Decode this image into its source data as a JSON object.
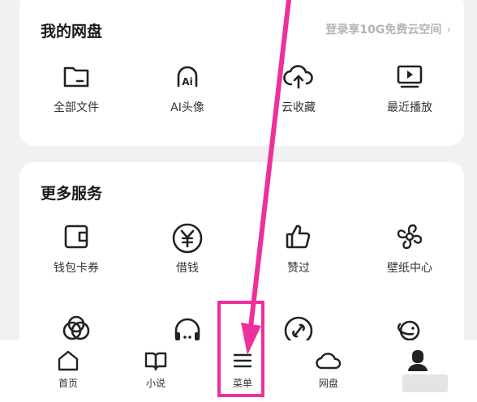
{
  "colors": {
    "background": "#f1f1f3",
    "card": "#ffffff",
    "icon": "#222222",
    "promo_text": "#b3b3b8",
    "annotation": "#ee2f9c"
  },
  "my_drive": {
    "title": "我的网盘",
    "promo_text": "登录享10G免费云空间",
    "promo_chevron": "›",
    "items": [
      {
        "label": "全部文件",
        "icon": "folder-icon"
      },
      {
        "label": "AI头像",
        "icon": "ai-avatar-icon"
      },
      {
        "label": "云收藏",
        "icon": "cloud-upload-icon"
      },
      {
        "label": "最近播放",
        "icon": "play-screen-icon"
      }
    ]
  },
  "more_services": {
    "title": "更多服务",
    "items": [
      {
        "label": "钱包卡券",
        "icon": "wallet-icon"
      },
      {
        "label": "借钱",
        "icon": "yuan-coin-icon"
      },
      {
        "label": "赞过",
        "icon": "thumbs-up-icon"
      },
      {
        "label": "壁纸中心",
        "icon": "pinwheel-icon"
      },
      {
        "label": "",
        "icon": "interlocking-rings-icon"
      },
      {
        "label": "",
        "icon": "headphones-icon"
      },
      {
        "label": "",
        "icon": "link-circle-icon"
      },
      {
        "label": "",
        "icon": "planet-icon"
      }
    ]
  },
  "bottom_nav": {
    "items": [
      {
        "label": "首页",
        "icon": "home-icon"
      },
      {
        "label": "小说",
        "icon": "book-icon"
      },
      {
        "label": "菜单",
        "icon": "menu-icon"
      },
      {
        "label": "网盘",
        "icon": "cloud-icon"
      },
      {
        "label": "",
        "icon": "profile-icon"
      }
    ],
    "highlighted": "菜单"
  }
}
